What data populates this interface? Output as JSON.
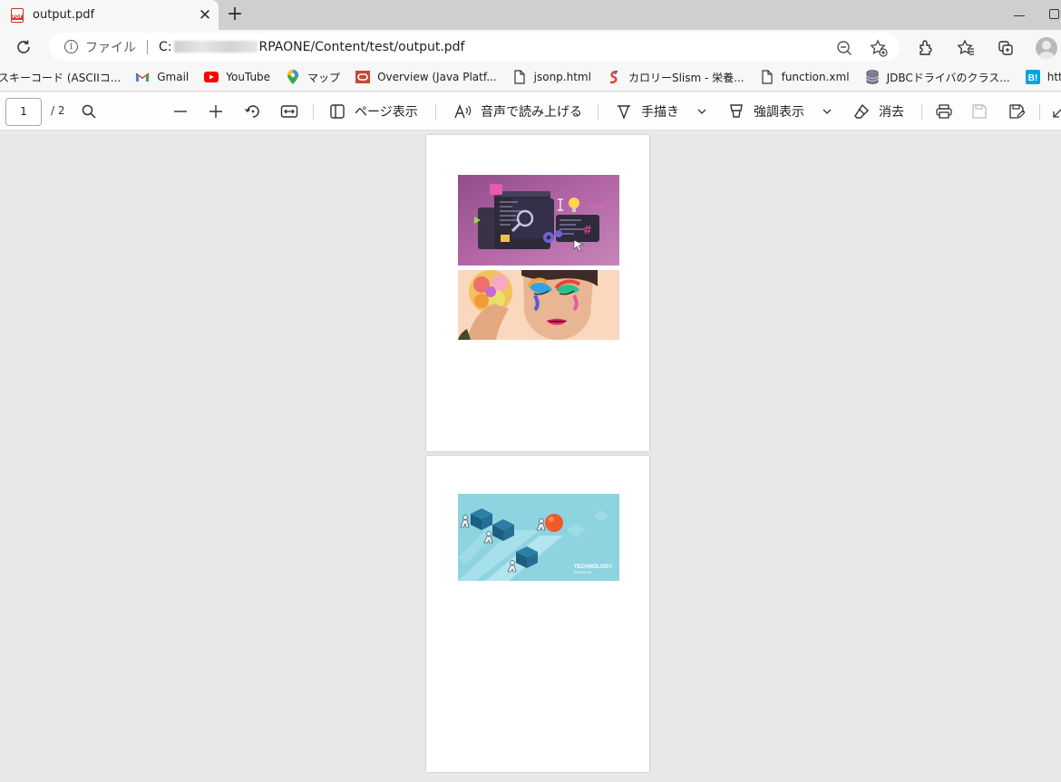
{
  "browser": {
    "tab_title": "output.pdf",
    "address_scheme_label": "ファイル",
    "address_prefix": "C:",
    "address_path": "RPAONE/Content/test/output.pdf"
  },
  "favorites": [
    {
      "label": "スキーコード (ASCIIコ...",
      "icon": "page-icon"
    },
    {
      "label": "Gmail",
      "icon": "gmail-icon"
    },
    {
      "label": "YouTube",
      "icon": "youtube-icon"
    },
    {
      "label": "マップ",
      "icon": "maps-pin-icon"
    },
    {
      "label": "Overview (Java Platf...",
      "icon": "oracle-icon"
    },
    {
      "label": "jsonp.html",
      "icon": "document-icon"
    },
    {
      "label": "カロリーSlism - 栄養...",
      "icon": "slism-icon"
    },
    {
      "label": "function.xml",
      "icon": "document-icon"
    },
    {
      "label": "JDBCドライバのクラス...",
      "icon": "database-icon"
    },
    {
      "label": "https://b.hatena.ne....",
      "icon": "hatena-icon"
    }
  ],
  "pdf_toolbar": {
    "current_page": "1",
    "total_pages": "/ 2",
    "page_view_label": "ページ表示",
    "read_aloud_label": "音声で読み上げる",
    "draw_label": "手描き",
    "highlight_label": "強調表示",
    "erase_label": "消去"
  },
  "document": {
    "page2_image_text_1": "TECHNOLOGY",
    "page2_image_text_2": "INNOVATION"
  },
  "colors": {
    "tabstrip": "#cfcfcf",
    "toolbar": "#f7f7f7",
    "canvas": "#e8e8e8",
    "youtube_red": "#ff0000",
    "hatena_blue": "#00a4de"
  }
}
